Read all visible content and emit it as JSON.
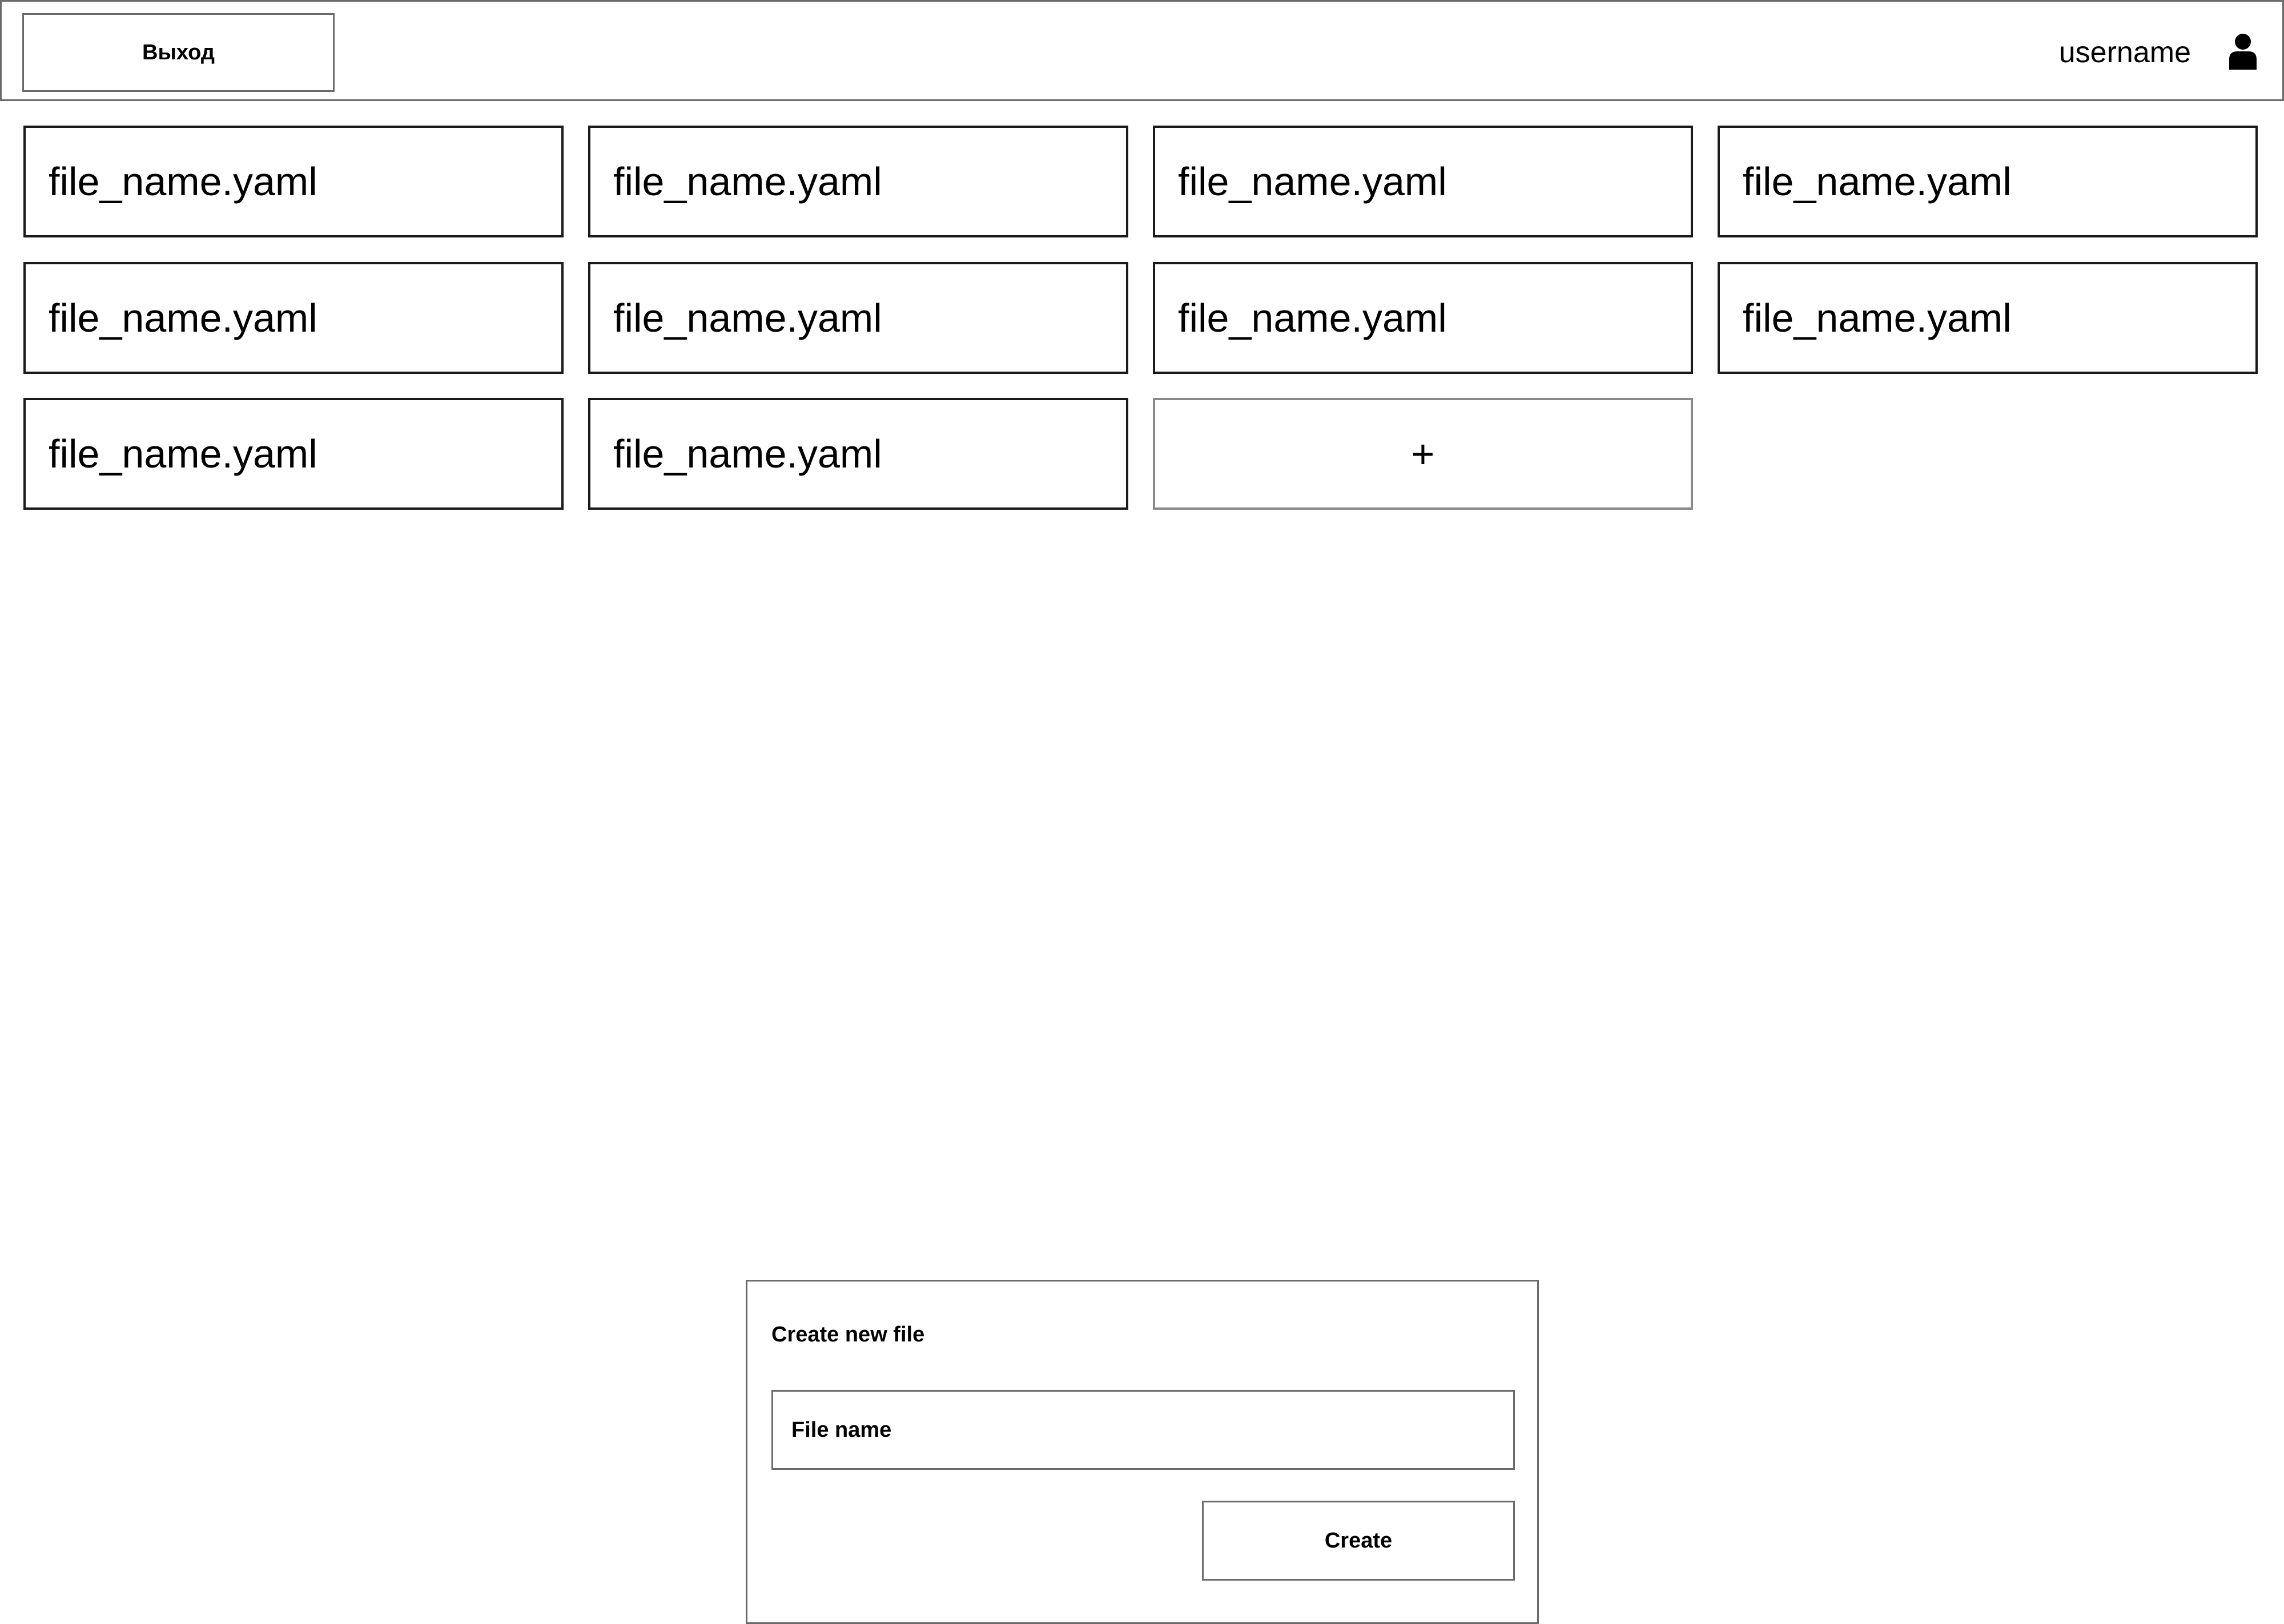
{
  "header": {
    "exit_label": "Выход",
    "username": "username",
    "user_icon": "user-icon"
  },
  "files": [
    {
      "name": "file_name.yaml"
    },
    {
      "name": "file_name.yaml"
    },
    {
      "name": "file_name.yaml"
    },
    {
      "name": "file_name.yaml"
    },
    {
      "name": "file_name.yaml"
    },
    {
      "name": "file_name.yaml"
    },
    {
      "name": "file_name.yaml"
    },
    {
      "name": "file_name.yaml"
    },
    {
      "name": "file_name.yaml"
    },
    {
      "name": "file_name.yaml"
    }
  ],
  "add_tile": {
    "label": "+"
  },
  "dialog": {
    "title": "Create new file",
    "input_placeholder": "File name",
    "input_value": "",
    "create_label": "Create"
  }
}
